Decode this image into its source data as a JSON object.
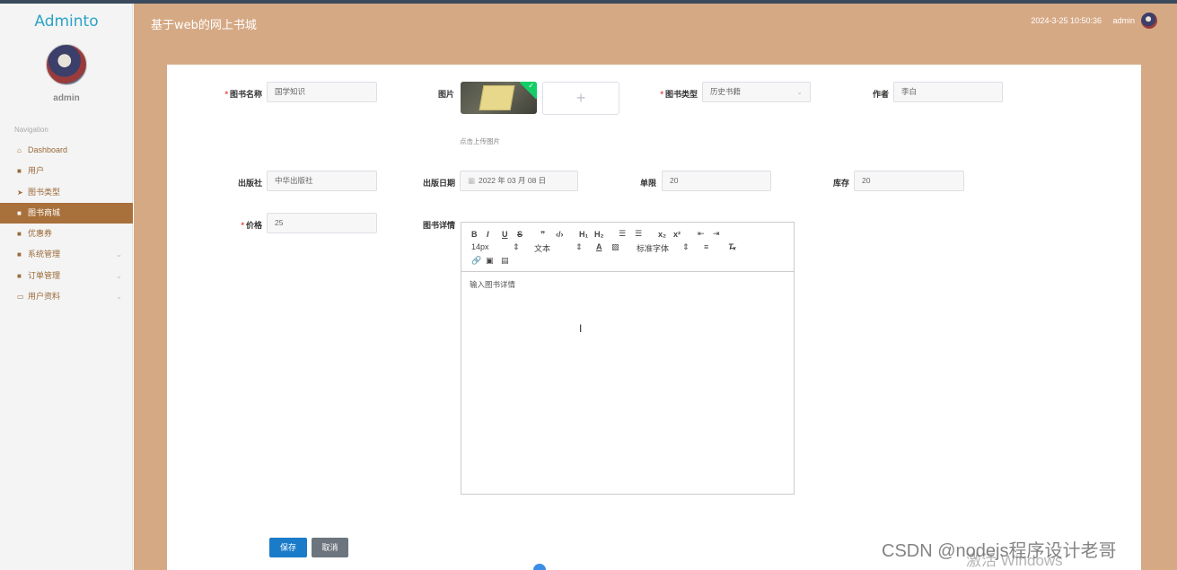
{
  "sidebar": {
    "logo": "Adminto",
    "username": "admin",
    "nav_heading": "Navigation",
    "items": [
      {
        "label": "Dashboard",
        "icon": "home-icon"
      },
      {
        "label": "用户",
        "icon": "grid-icon"
      },
      {
        "label": "图书类型",
        "icon": "send-icon"
      },
      {
        "label": "图书商城",
        "icon": "grid-icon",
        "active": true
      },
      {
        "label": "优惠券",
        "icon": "grid-icon"
      },
      {
        "label": "系统管理",
        "icon": "grid-icon",
        "expandable": true
      },
      {
        "label": "订单管理",
        "icon": "grid-icon",
        "expandable": true
      },
      {
        "label": "用户资料",
        "icon": "card-icon",
        "expandable": true
      }
    ]
  },
  "header": {
    "title": "基于web的网上书城",
    "datetime": "2024-3-25 10:50:36",
    "user": "admin"
  },
  "form": {
    "book_name": {
      "label": "图书名称",
      "value": "国学知识"
    },
    "image": {
      "label": "图片",
      "tip": "点击上传图片",
      "plus": "+"
    },
    "book_type": {
      "label": "图书类型",
      "value": "历史书籍"
    },
    "author": {
      "label": "作者",
      "value": "李白"
    },
    "publisher": {
      "label": "出版社",
      "value": "中华出版社"
    },
    "publish_date": {
      "label": "出版日期",
      "value": "2022 年 03 月 08 日"
    },
    "limit": {
      "label": "单限",
      "value": "20"
    },
    "stock": {
      "label": "库存",
      "value": "20"
    },
    "price": {
      "label": "价格",
      "value": "25"
    },
    "details": {
      "label": "图书详情",
      "placeholder": "输入图书详情",
      "font_size": "14px",
      "text_style": "文本",
      "font_family": "标准字体"
    }
  },
  "buttons": {
    "save": "保存",
    "cancel": "取消"
  },
  "watermarks": {
    "windows": "激活 Windows",
    "csdn": "CSDN @nodejs程序设计老哥"
  },
  "colors": {
    "header": "#d6a985",
    "active_nav": "#a8703a",
    "primary": "#1a7bc8",
    "logo": "#2aa4c8"
  }
}
